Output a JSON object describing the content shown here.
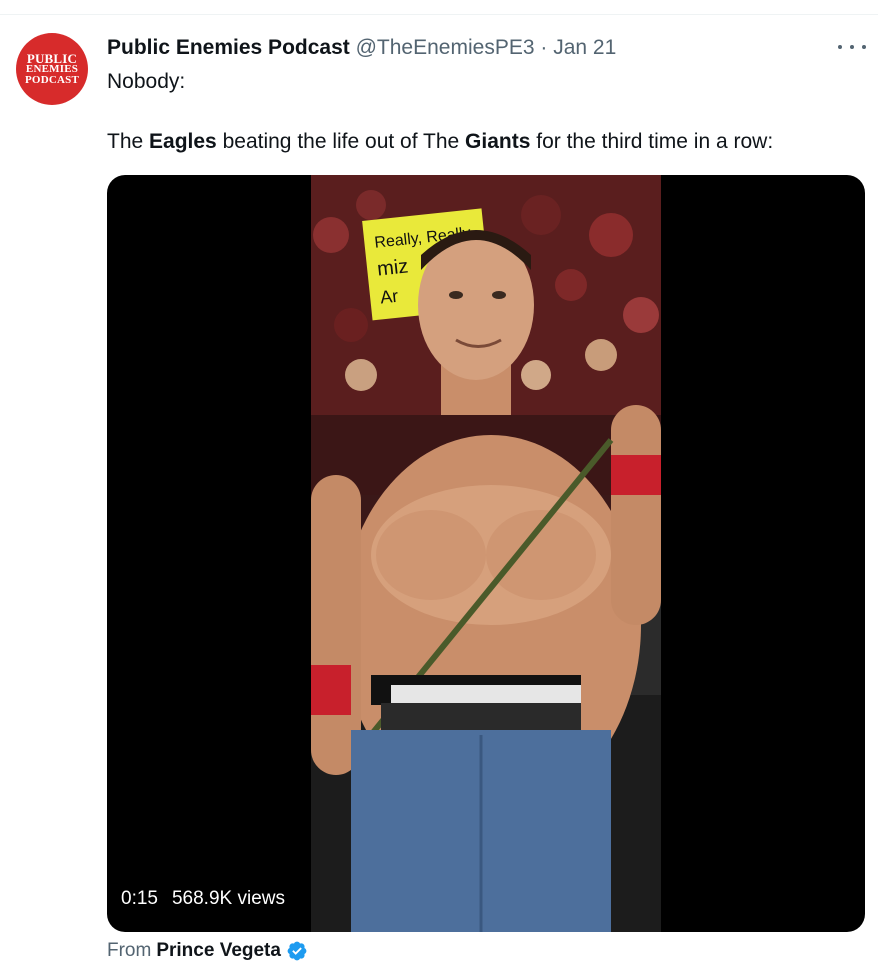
{
  "tweet": {
    "author": {
      "display_name": "Public Enemies Podcast",
      "handle": "@TheEnemiesPE3",
      "avatar_text": [
        "PUBLIC",
        "ENEMIES",
        "PODCAST"
      ],
      "avatar_color": "#d72b2b"
    },
    "separator": "·",
    "date": "Jan 21",
    "more_icon": "more-horizontal-icon",
    "text": {
      "line1": "Nobody:",
      "line2_before_eagles": "The ",
      "eagles": "Eagles",
      "line2_middle": " beating the life out of The ",
      "giants": "Giants",
      "line2_after": " for the third time in a row:"
    },
    "media": {
      "duration": "0:15",
      "views": "568.9K views",
      "sign_text": [
        "Really, Really",
        "miz",
        "Ar"
      ]
    },
    "attribution": {
      "prefix": "From",
      "source": "Prince Vegeta",
      "verified_icon": "verified-badge-icon"
    }
  },
  "colors": {
    "text_primary": "#0f1419",
    "text_secondary": "#536471",
    "verified_blue": "#1d9bf0",
    "media_bg": "#000000"
  }
}
